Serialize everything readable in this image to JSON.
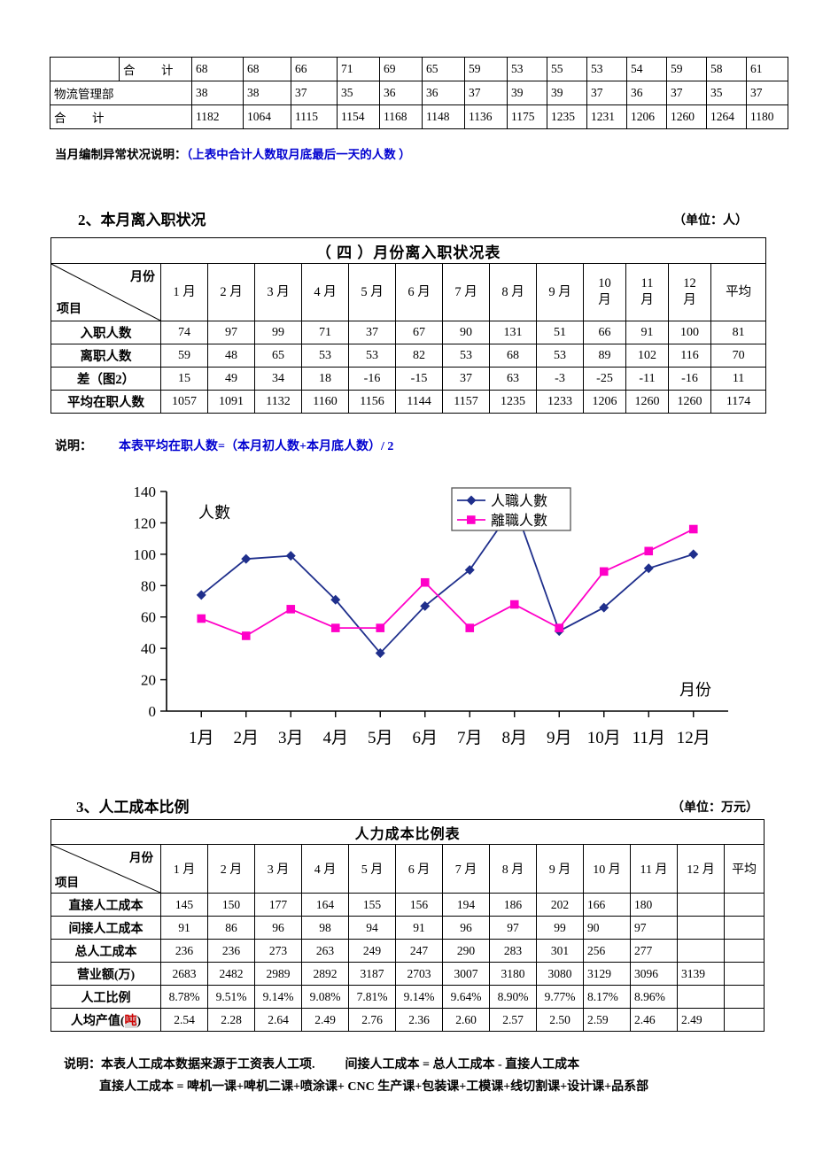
{
  "table1": {
    "rows": [
      {
        "label": "",
        "label2": "合　计",
        "values": [
          "68",
          "68",
          "66",
          "71",
          "69",
          "65",
          "59",
          "53",
          "55",
          "53",
          "54",
          "59",
          "58",
          "61"
        ]
      },
      {
        "label": "物流管理部",
        "label2": "",
        "values": [
          "38",
          "38",
          "37",
          "35",
          "36",
          "36",
          "37",
          "39",
          "39",
          "37",
          "36",
          "37",
          "35",
          "37"
        ]
      },
      {
        "label": "合　计",
        "label2": "",
        "values": [
          "1182",
          "1064",
          "1115",
          "1154",
          "1168",
          "1148",
          "1136",
          "1175",
          "1235",
          "1231",
          "1206",
          "1260",
          "1264",
          "1180"
        ]
      }
    ]
  },
  "note1": {
    "black": "当月编制异常状况说明：",
    "blue": "（上表中合计人数取月底最后一天的人数 ）"
  },
  "section2": {
    "heading": "2、本月离入职状况",
    "unit": "（单位：人）",
    "table": {
      "title": "（ 四 ）月份离入职状况表",
      "corner_month": "月份",
      "corner_item": "项目",
      "columns": [
        "1 月",
        "2 月",
        "3 月",
        "4 月",
        "5 月",
        "6 月",
        "7 月",
        "8 月",
        "9 月",
        "10\n月",
        "11\n月",
        "12\n月",
        "平均"
      ],
      "rows": [
        {
          "label": "入职人数",
          "values": [
            "74",
            "97",
            "99",
            "71",
            "37",
            "67",
            "90",
            "131",
            "51",
            "66",
            "91",
            "100",
            "81"
          ]
        },
        {
          "label": "离职人数",
          "values": [
            "59",
            "48",
            "65",
            "53",
            "53",
            "82",
            "53",
            "68",
            "53",
            "89",
            "102",
            "116",
            "70"
          ]
        },
        {
          "label": "差（图2）",
          "values": [
            "15",
            "49",
            "34",
            "18",
            "-16",
            "-15",
            "37",
            "63",
            "-3",
            "-25",
            "-11",
            "-16",
            "11"
          ]
        },
        {
          "label": "平均在职人数",
          "values": [
            "1057",
            "1091",
            "1132",
            "1160",
            "1156",
            "1144",
            "1157",
            "1235",
            "1233",
            "1206",
            "1260",
            "1260",
            "1174"
          ]
        }
      ]
    },
    "note_black": "说明：",
    "note_blue": "本表平均在职人数=（本月初人数+本月底人数）/ 2"
  },
  "chart_data": {
    "type": "line",
    "title": "",
    "ylabel": "人數",
    "xlabel": "月份",
    "categories": [
      "1月",
      "2月",
      "3月",
      "4月",
      "5月",
      "6月",
      "7月",
      "8月",
      "9月",
      "10月",
      "11月",
      "12月"
    ],
    "ylim": [
      0,
      140
    ],
    "yticks": [
      "0",
      "20",
      "40",
      "60",
      "80",
      "100",
      "120",
      "140"
    ],
    "grid": false,
    "legend_position": "top-right",
    "series": [
      {
        "name": "人職人數",
        "color": "#1f2f8c",
        "marker": "diamond",
        "values": [
          74,
          97,
          99,
          71,
          37,
          67,
          90,
          131,
          51,
          66,
          91,
          100
        ]
      },
      {
        "name": "離職人數",
        "color": "#ff00c8",
        "marker": "square",
        "values": [
          59,
          48,
          65,
          53,
          53,
          82,
          53,
          68,
          53,
          89,
          102,
          116
        ]
      }
    ]
  },
  "section3": {
    "heading": "3、人工成本比例",
    "unit": "（单位：万元）",
    "table": {
      "title": "人力成本比例表",
      "corner_month": "月份",
      "corner_item": "项目",
      "columns": [
        "1 月",
        "2 月",
        "3 月",
        "4 月",
        "5 月",
        "6 月",
        "7 月",
        "8 月",
        "9 月",
        "10 月",
        "11 月",
        "12 月",
        "平均"
      ],
      "rows": [
        {
          "label": "直接人工成本",
          "label_unit": "",
          "values": [
            "145",
            "150",
            "177",
            "164",
            "155",
            "156",
            "194",
            "186",
            "202",
            "166",
            "180",
            "",
            ""
          ]
        },
        {
          "label": "间接人工成本",
          "label_unit": "",
          "values": [
            "91",
            "86",
            "96",
            "98",
            "94",
            "91",
            "96",
            "97",
            "99",
            "90",
            "97",
            "",
            ""
          ]
        },
        {
          "label": "总人工成本",
          "label_unit": "",
          "values": [
            "236",
            "236",
            "273",
            "263",
            "249",
            "247",
            "290",
            "283",
            "301",
            "256",
            "277",
            "",
            ""
          ]
        },
        {
          "label": "营业额(万)",
          "label_unit": "",
          "values": [
            "2683",
            "2482",
            "2989",
            "2892",
            "3187",
            "2703",
            "3007",
            "3180",
            "3080",
            "3129",
            "3096",
            "3139",
            ""
          ]
        },
        {
          "label": "人工比例",
          "label_unit": "",
          "values": [
            "8.78%",
            "9.51%",
            "9.14%",
            "9.08%",
            "7.81%",
            "9.14%",
            "9.64%",
            "8.90%",
            "9.77%",
            "8.17%",
            "8.96%",
            "",
            ""
          ]
        },
        {
          "label": "人均产值(",
          "label_unit": "吨",
          "label_tail": ")",
          "values": [
            "2.54",
            "2.28",
            "2.64",
            "2.49",
            "2.76",
            "2.36",
            "2.60",
            "2.57",
            "2.50",
            "2.59",
            "2.46",
            "2.49",
            ""
          ]
        }
      ]
    },
    "note_line1_a": "说明：本表人工成本数据来源于工资表人工项.",
    "note_line1_b": "间接人工成本 = 总人工成本 - 直接人工成本",
    "note_line2": "直接人工成本 = 啤机一课+啤机二课+喷涂课+ CNC 生产课+包装课+工模课+线切割课+设计课+品系部"
  }
}
